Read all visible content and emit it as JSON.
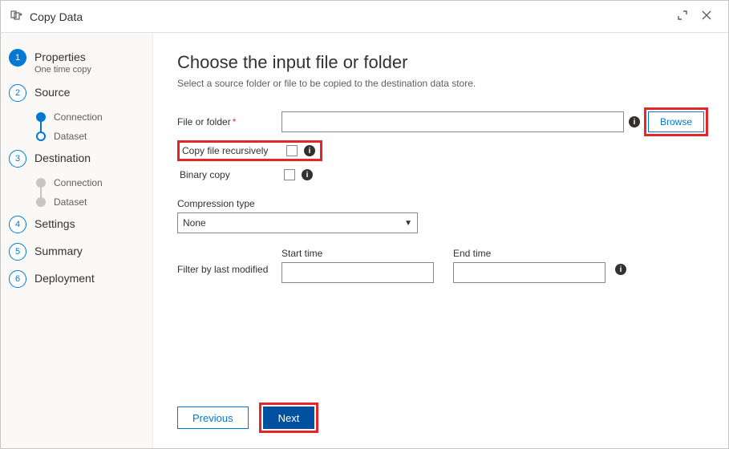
{
  "window": {
    "title": "Copy Data"
  },
  "sidebar": {
    "steps": [
      {
        "label": "Properties",
        "sublabel": "One time copy"
      },
      {
        "label": "Source"
      },
      {
        "label": "Destination"
      },
      {
        "label": "Settings"
      },
      {
        "label": "Summary"
      },
      {
        "label": "Deployment"
      }
    ],
    "source_substeps": [
      {
        "label": "Connection"
      },
      {
        "label": "Dataset"
      }
    ],
    "dest_substeps": [
      {
        "label": "Connection"
      },
      {
        "label": "Dataset"
      }
    ]
  },
  "main": {
    "title": "Choose the input file or folder",
    "description": "Select a source folder or file to be copied to the destination data store.",
    "file_or_folder_label": "File or folder",
    "file_or_folder_value": "",
    "browse_label": "Browse",
    "copy_recursive_label": "Copy file recursively",
    "binary_copy_label": "Binary copy",
    "compression_label": "Compression type",
    "compression_value": "None",
    "filter_label": "Filter by last modified",
    "start_time_label": "Start time",
    "start_time_value": "",
    "end_time_label": "End time",
    "end_time_value": ""
  },
  "footer": {
    "previous": "Previous",
    "next": "Next"
  }
}
